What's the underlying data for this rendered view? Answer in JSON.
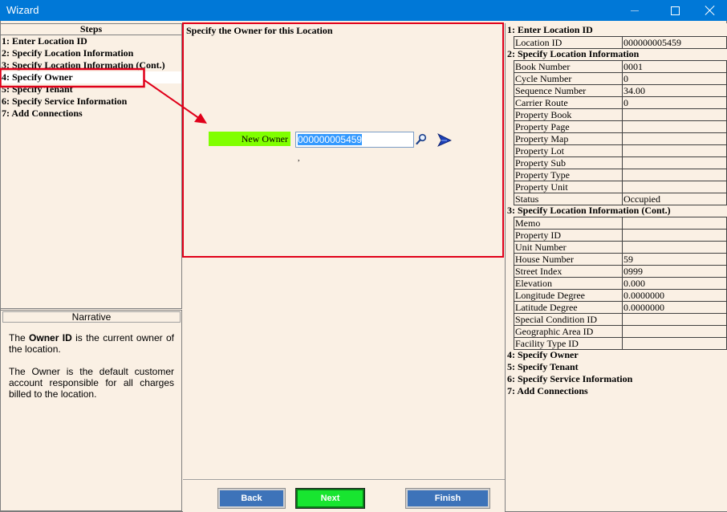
{
  "window": {
    "title": "Wizard"
  },
  "steps": {
    "header": "Steps",
    "items": [
      "1: Enter Location ID",
      "2: Specify Location Information",
      "3: Specify Location Information (Cont.)",
      "4: Specify Owner",
      "5: Specify Tenant",
      "6: Specify Service Information",
      "7: Add Connections"
    ],
    "selected_index": 3
  },
  "narrative": {
    "header": "Narrative",
    "p1_before": "The ",
    "p1_bold": "Owner ID",
    "p1_after": " is the current owner of the location.",
    "p2": "The Owner is the default customer account responsible for all charges billed to the location."
  },
  "center": {
    "title": "Specify the Owner for this Location",
    "owner_label": "New Owner",
    "owner_value": "000000005459",
    "stray": ","
  },
  "buttons": {
    "back": "Back",
    "next": "Next",
    "finish": "Finish"
  },
  "summary": {
    "sections": [
      {
        "title": "1: Enter Location ID",
        "rows": [
          {
            "label": "Location ID",
            "value": "000000005459"
          }
        ]
      },
      {
        "title": "2: Specify Location Information",
        "rows": [
          {
            "label": "Book Number",
            "value": "0001"
          },
          {
            "label": "Cycle Number",
            "value": "0"
          },
          {
            "label": "Sequence Number",
            "value": "34.00"
          },
          {
            "label": "Carrier Route",
            "value": "0"
          },
          {
            "label": "Property Book",
            "value": ""
          },
          {
            "label": "Property Page",
            "value": ""
          },
          {
            "label": "Property Map",
            "value": ""
          },
          {
            "label": "Property Lot",
            "value": ""
          },
          {
            "label": "Property Sub",
            "value": ""
          },
          {
            "label": "Property Type",
            "value": ""
          },
          {
            "label": "Property Unit",
            "value": ""
          },
          {
            "label": "Status",
            "value": "Occupied"
          }
        ]
      },
      {
        "title": "3: Specify Location Information (Cont.)",
        "rows": [
          {
            "label": "Memo",
            "value": ""
          },
          {
            "label": "Property ID",
            "value": ""
          },
          {
            "label": "Unit Number",
            "value": ""
          },
          {
            "label": "House Number",
            "value": "59"
          },
          {
            "label": "Street Index",
            "value": "0999"
          },
          {
            "label": "Elevation",
            "value": "0.000"
          },
          {
            "label": "Longitude Degree",
            "value": "0.0000000"
          },
          {
            "label": "Latitude Degree",
            "value": "0.0000000"
          },
          {
            "label": "Special Condition ID",
            "value": ""
          },
          {
            "label": "Geographic Area ID",
            "value": ""
          },
          {
            "label": "Facility Type ID",
            "value": ""
          }
        ]
      },
      {
        "title": "4: Specify Owner",
        "rows": []
      },
      {
        "title": "5: Specify Tenant",
        "rows": []
      },
      {
        "title": "6: Specify Service Information",
        "rows": []
      },
      {
        "title": "7: Add Connections",
        "rows": []
      }
    ]
  },
  "colors": {
    "titlebar": "#0078d7",
    "background": "#faf0e4",
    "highlight_red": "#e0001a",
    "label_green": "#80ff00",
    "next_green": "#18e530",
    "button_blue": "#3d73b9",
    "selection_blue": "#3399ff"
  },
  "icons": [
    "minimize-icon",
    "maximize-icon",
    "close-icon",
    "search-icon",
    "navigate-arrow-icon"
  ]
}
